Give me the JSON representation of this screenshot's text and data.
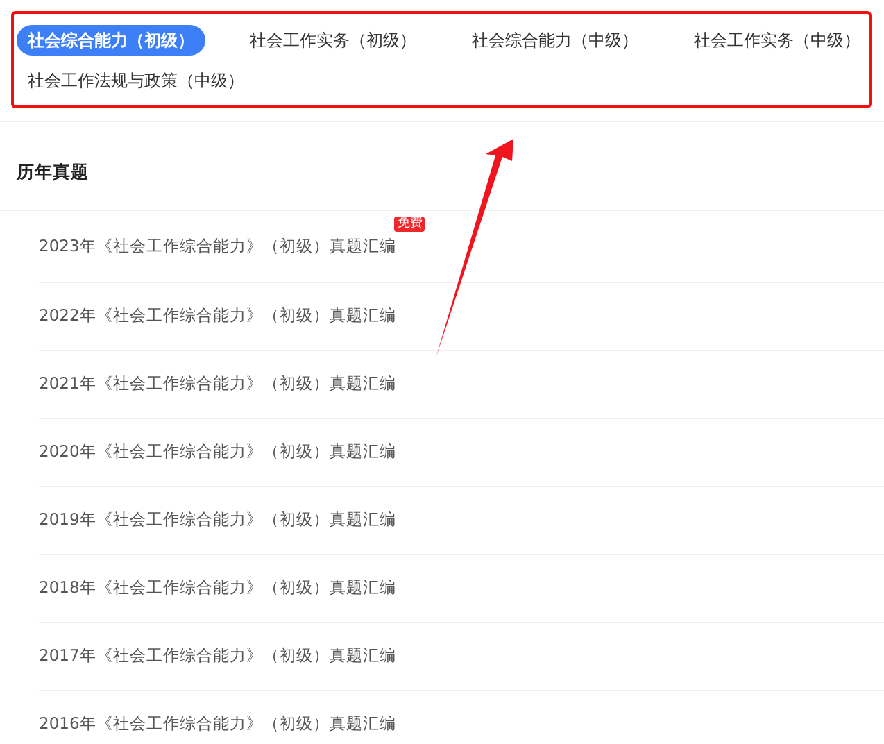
{
  "tabs": [
    {
      "label": "社会综合能力（初级）",
      "selected": true
    },
    {
      "label": "社会工作实务（初级）",
      "selected": false
    },
    {
      "label": "社会综合能力（中级）",
      "selected": false
    },
    {
      "label": "社会工作实务（中级）",
      "selected": false
    },
    {
      "label": "社会工作法规与政策（中级）",
      "selected": false
    }
  ],
  "section": {
    "title": "历年真题",
    "items": [
      {
        "title": "2023年《社会工作综合能力》（初级）真题汇编",
        "badge": "免费"
      },
      {
        "title": "2022年《社会工作综合能力》（初级）真题汇编"
      },
      {
        "title": "2021年《社会工作综合能力》（初级）真题汇编"
      },
      {
        "title": "2020年《社会工作综合能力》（初级）真题汇编"
      },
      {
        "title": "2019年《社会工作综合能力》（初级）真题汇编"
      },
      {
        "title": "2018年《社会工作综合能力》（初级）真题汇编"
      },
      {
        "title": "2017年《社会工作综合能力》（初级）真题汇编"
      },
      {
        "title": "2016年《社会工作综合能力》（初级）真题汇编"
      }
    ]
  }
}
